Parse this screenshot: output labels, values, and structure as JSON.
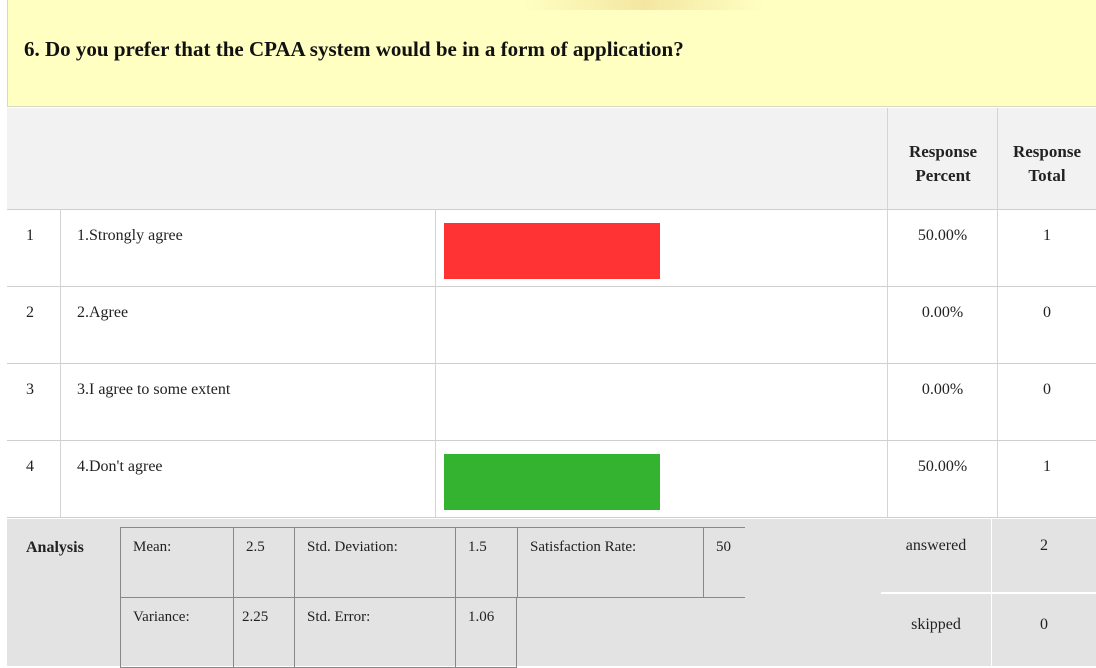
{
  "question": {
    "title": "6. Do you prefer that the CPAA system would be in a form of application?"
  },
  "headers": {
    "response_percent": "Response Percent",
    "response_total": "Response Total"
  },
  "rows": [
    {
      "num": "1",
      "label": "1.Strongly agree",
      "percent": "50.00%",
      "total": "1",
      "share": 0.5,
      "color": "#ff3333"
    },
    {
      "num": "2",
      "label": "2.Agree",
      "percent": "0.00%",
      "total": "0",
      "share": 0.0,
      "color": ""
    },
    {
      "num": "3",
      "label": "3.I agree to some extent",
      "percent": "0.00%",
      "total": "0",
      "share": 0.0,
      "color": ""
    },
    {
      "num": "4",
      "label": "4.Don't agree",
      "percent": "50.00%",
      "total": "1",
      "share": 0.5,
      "color": "#33b32f"
    }
  ],
  "analysis": {
    "label": "Analysis",
    "mean_label": "Mean:",
    "mean": "2.5",
    "std_dev_label": "Std. Deviation:",
    "std_dev": "1.5",
    "satisfaction_label": "Satisfaction Rate:",
    "satisfaction": "50",
    "variance_label": "Variance:",
    "variance": "2.25",
    "std_error_label": "Std. Error:",
    "std_error": "1.06"
  },
  "summary": {
    "answered_label": "answered",
    "answered": "2",
    "skipped_label": "skipped",
    "skipped": "0"
  }
}
